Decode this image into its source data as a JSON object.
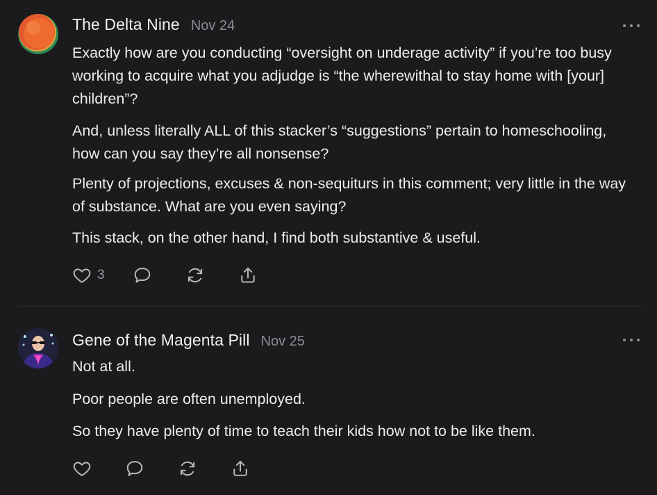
{
  "comments": [
    {
      "author": "The Delta Nine",
      "date": "Nov 24",
      "paragraphs": [
        "Exactly how are you conducting “oversight on underage activity” if you’re too busy working to acquire what you adjudge is “the wherewithal to stay home with [your] children”?",
        "And, unless literally ALL of this stacker’s “suggestions” pertain to homeschooling, how can you say they’re all nonsense?",
        "Plenty of projections, excuses & non-sequiturs in this comment; very little in the way of substance. What are you even saying?",
        "This stack, on the other hand, I find both substantive & useful."
      ],
      "like_count": "3"
    },
    {
      "author": "Gene of the Magenta Pill",
      "date": "Nov 25",
      "paragraphs": [
        "Not at all.",
        "Poor people are often unemployed.",
        "So they have plenty of time to teach their kids how not to be like them."
      ]
    }
  ],
  "icons": {
    "like": "heart-icon",
    "reply": "comment-bubble-icon",
    "restack": "restack-icon",
    "share": "share-icon",
    "more": "more-options-icon"
  },
  "colors": {
    "background": "#1b1b1d",
    "text": "#ededf0",
    "muted": "#8b8b92",
    "icon": "#b9b9be"
  }
}
